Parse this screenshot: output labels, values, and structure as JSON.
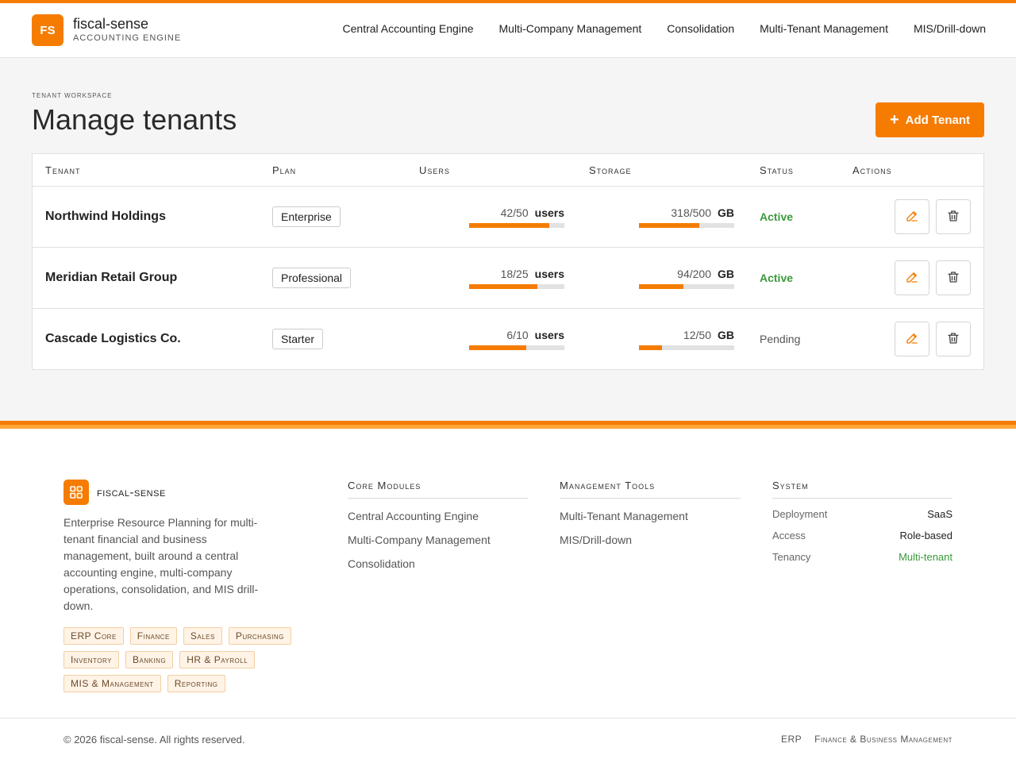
{
  "brand": {
    "initials": "FS",
    "name": "fiscal-sense",
    "subtitle": "ACCOUNTING ENGINE"
  },
  "nav": [
    "Central Accounting Engine",
    "Multi-Company Management",
    "Consolidation",
    "Multi-Tenant Management",
    "MIS/Drill-down"
  ],
  "page": {
    "eyebrow": "TENANT WORKSPACE",
    "title": "Manage tenants",
    "add_button": "Add Tenant"
  },
  "table": {
    "headers": [
      "Tenant",
      "Plan",
      "Users",
      "Storage",
      "Status",
      "Actions"
    ],
    "rows": [
      {
        "tenant": "Northwind Holdings",
        "plan": "Enterprise",
        "users_text": "42/50",
        "users_unit": "users",
        "users_fraction": 0.84,
        "storage_text": "318/500",
        "storage_unit": "GB",
        "storage_fraction": 0.636,
        "status": "Active",
        "status_type": "active"
      },
      {
        "tenant": "Meridian Retail Group",
        "plan": "Professional",
        "users_text": "18/25",
        "users_unit": "users",
        "users_fraction": 0.72,
        "storage_text": "94/200",
        "storage_unit": "GB",
        "storage_fraction": 0.47,
        "status": "Active",
        "status_type": "active"
      },
      {
        "tenant": "Cascade Logistics Co.",
        "plan": "Starter",
        "users_text": "6/10",
        "users_unit": "users",
        "users_fraction": 0.6,
        "storage_text": "12/50",
        "storage_unit": "GB",
        "storage_fraction": 0.24,
        "status": "Pending",
        "status_type": "pending"
      }
    ]
  },
  "footer": {
    "brand": "fiscal-sense",
    "description": "Enterprise Resource Planning for multi-tenant financial and business management, built around a central accounting engine, multi-company operations, consolidation, and MIS drill-down.",
    "tags": [
      "ERP Core",
      "Finance",
      "Sales",
      "Purchasing",
      "Inventory",
      "Banking",
      "HR & Payroll",
      "MIS & Management",
      "Reporting"
    ],
    "core_modules": {
      "title": "Core Modules",
      "links": [
        "Central Accounting Engine",
        "Multi-Company Management",
        "Consolidation"
      ]
    },
    "management_tools": {
      "title": "Management Tools",
      "links": [
        "Multi-Tenant Management",
        "MIS/Drill-down"
      ]
    },
    "system": {
      "title": "System",
      "items": [
        {
          "key": "Deployment",
          "value": "SaaS"
        },
        {
          "key": "Access",
          "value": "Role-based"
        },
        {
          "key": "Tenancy",
          "value": "Multi-tenant"
        }
      ]
    },
    "copyright": "© 2026 fiscal-sense. All rights reserved.",
    "bottom_links": [
      "ERP",
      "Finance & Business Management"
    ]
  },
  "colors": {
    "accent": "#f57c00",
    "accent_light": "#ffa53a",
    "active": "#3a9a3a"
  }
}
